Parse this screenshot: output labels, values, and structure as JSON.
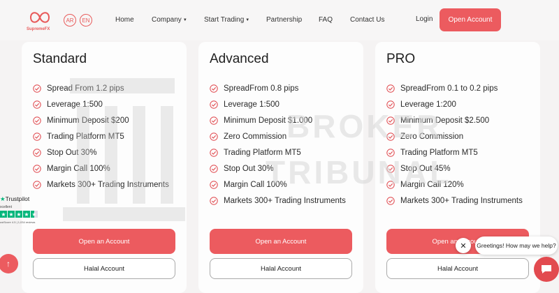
{
  "header": {
    "logo_text": "SupremeFX",
    "languages": [
      "AR",
      "EN"
    ],
    "nav": [
      {
        "label": "Home",
        "dropdown": false
      },
      {
        "label": "Company",
        "dropdown": true
      },
      {
        "label": "Start Trading",
        "dropdown": true
      },
      {
        "label": "Partnership",
        "dropdown": false
      },
      {
        "label": "FAQ",
        "dropdown": false
      },
      {
        "label": "Contact Us",
        "dropdown": false
      }
    ],
    "login_label": "Login",
    "open_account_label": "Open Account"
  },
  "watermark": {
    "line1": "BROKER",
    "line2": "TRIBUNAL"
  },
  "plans": [
    {
      "title": "Standard",
      "features": [
        "Spread From 1.2 pips",
        "Leverage 1:500",
        "Minimum Deposit $200",
        "Trading Platform MT5",
        "Stop Out 30%",
        "Margin Call 100%",
        "Markets 300+ Trading Instruments"
      ],
      "primary_label": "Open an Account",
      "secondary_label": "Halal Account"
    },
    {
      "title": "Advanced",
      "features": [
        "SpreadFrom 0.8 pips",
        "Leverage 1:500",
        "Minimum Deposit $1.000",
        "Zero Commission",
        "Trading Platform MT5",
        "Stop Out 30%",
        "Margin Call 100%",
        "Markets 300+ Trading Instruments"
      ],
      "primary_label": "Open an Account",
      "secondary_label": "Halal Account"
    },
    {
      "title": "PRO",
      "features": [
        "SpreadFrom 0.1 to 0.2 pips",
        "Leverage 1:200",
        "Minimum Deposit $2.500",
        "Zero Commission",
        "Trading Platform MT5",
        "Stop Out 45%",
        "Margin Call 120%",
        "Markets 300+ Trading Instruments"
      ],
      "primary_label": "Open an Account",
      "secondary_label": "Halal Account"
    }
  ],
  "trustpilot": {
    "brand": "Trustpilot",
    "rating_word": "xcellent",
    "score_text": "ustScore 4.5 | 1,034 reviews"
  },
  "chat": {
    "greeting": "Greetings! How may we help?",
    "close_icon": "close-icon",
    "launcher_icon": "chat-icon"
  },
  "colors": {
    "accent": "#ec5b5f",
    "check": "#e0474c",
    "trustpilot": "#00b67a"
  }
}
